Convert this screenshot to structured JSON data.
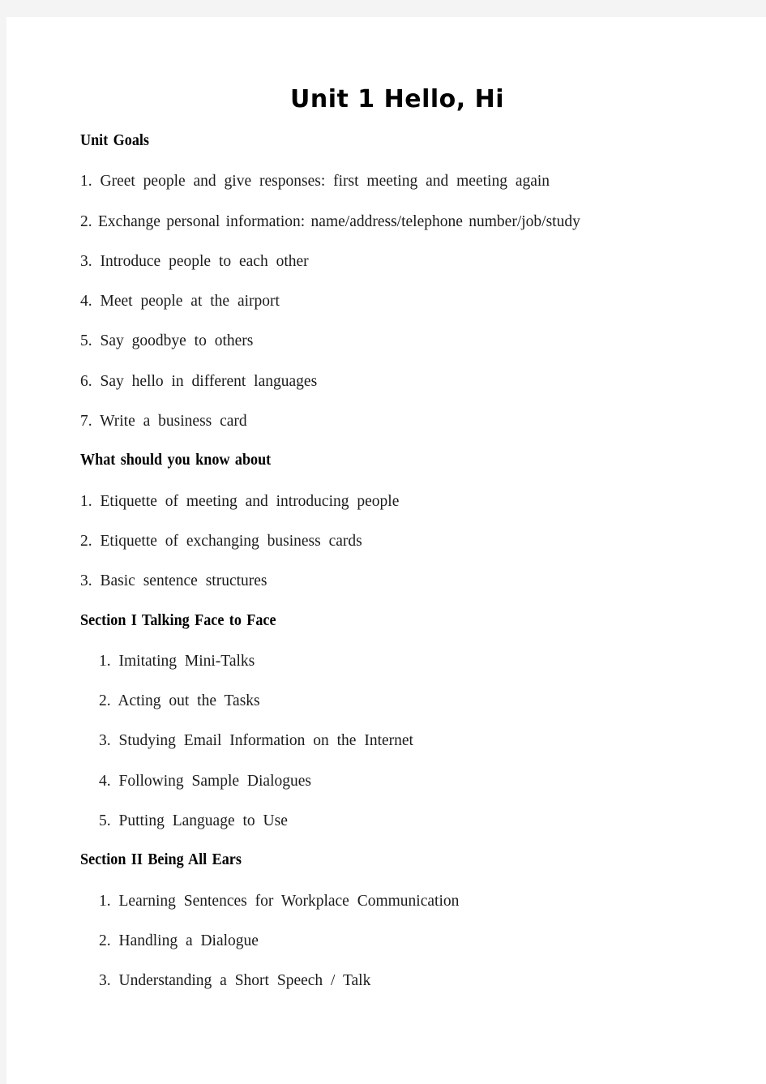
{
  "document": {
    "title": "Unit 1 Hello, Hi",
    "page_background": "#ffffff",
    "frame_background": "#f4f4f4",
    "text_color": "#1b1b1b",
    "sections": [
      {
        "heading": "Unit Goals",
        "indent": false,
        "items": [
          "1. Greet people and give responses: first meeting and meeting again",
          "2. Exchange personal information: name/address/telephone number/job/study",
          "3. Introduce people to each other",
          "4. Meet people at the airport",
          "5. Say goodbye to others",
          "6. Say hello in different languages",
          "7. Write a business card"
        ]
      },
      {
        "heading": "What should you know about",
        "indent": false,
        "items": [
          "1. Etiquette of meeting and introducing people",
          "2. Etiquette of exchanging business cards",
          "3. Basic sentence structures"
        ]
      },
      {
        "heading": "Section I Talking Face to Face",
        "indent": true,
        "items": [
          "1. Imitating Mini-Talks",
          "2. Acting out the Tasks",
          "3. Studying Email Information on the Internet",
          "4. Following Sample Dialogues",
          "5. Putting Language to Use"
        ]
      },
      {
        "heading": "Section II Being All Ears",
        "indent": true,
        "items": [
          "1. Learning Sentences for Workplace Communication",
          "2. Handling a Dialogue",
          "3. Understanding a Short Speech / Talk"
        ]
      }
    ]
  }
}
